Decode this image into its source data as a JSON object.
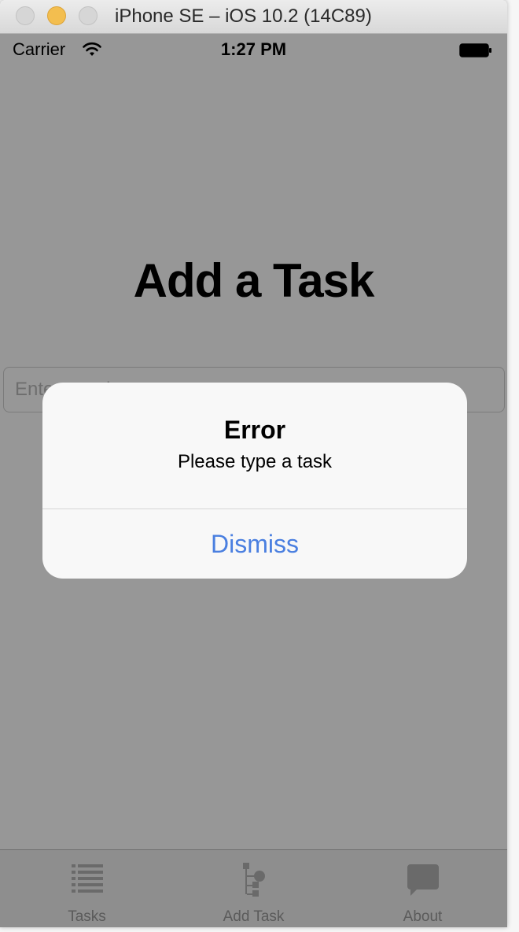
{
  "window": {
    "title": "iPhone SE – iOS 10.2 (14C89)"
  },
  "status_bar": {
    "carrier": "Carrier",
    "time": "1:27 PM"
  },
  "page": {
    "title": "Add a Task",
    "input_placeholder": "Enter a task"
  },
  "alert": {
    "title": "Error",
    "message": "Please type a task",
    "button_label": "Dismiss",
    "button_color": "#4a7fe0"
  },
  "tab_bar": {
    "items": [
      {
        "label": "Tasks",
        "icon": "list-icon"
      },
      {
        "label": "Add Task",
        "icon": "tree-icon"
      },
      {
        "label": "About",
        "icon": "chat-bubble-icon"
      }
    ]
  },
  "colors": {
    "dim_overlay": "#979797",
    "traffic_minimize": "#f3be4f"
  }
}
